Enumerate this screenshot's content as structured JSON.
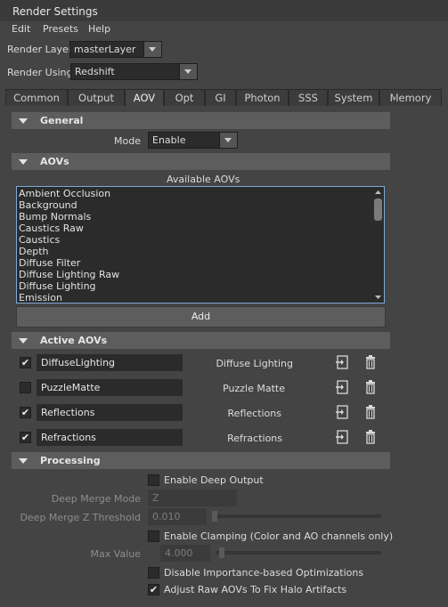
{
  "window": {
    "title": "Render Settings"
  },
  "menu": [
    "Edit",
    "Presets",
    "Help"
  ],
  "render_layer": {
    "label": "Render Layer",
    "value": "masterLayer"
  },
  "render_using": {
    "label": "Render Using",
    "value": "Redshift"
  },
  "tabs": [
    "Common",
    "Output",
    "AOV",
    "Opt",
    "GI",
    "Photon",
    "SSS",
    "System",
    "Memory"
  ],
  "active_tab": "AOV",
  "general": {
    "title": "General",
    "mode_label": "Mode",
    "mode_value": "Enable"
  },
  "aovs": {
    "title": "AOVs",
    "available_label": "Available AOVs",
    "items": [
      "Ambient Occlusion",
      "Background",
      "Bump Normals",
      "Caustics Raw",
      "Caustics",
      "Depth",
      "Diffuse Filter",
      "Diffuse Lighting Raw",
      "Diffuse Lighting",
      "Emission"
    ],
    "add_label": "Add"
  },
  "active_aovs": {
    "title": "Active AOVs",
    "rows": [
      {
        "checked": true,
        "name": "DiffuseLighting",
        "type": "Diffuse Lighting"
      },
      {
        "checked": false,
        "name": "PuzzleMatte",
        "type": "Puzzle Matte"
      },
      {
        "checked": true,
        "name": "Reflections",
        "type": "Reflections"
      },
      {
        "checked": true,
        "name": "Refractions",
        "type": "Refractions"
      }
    ]
  },
  "processing": {
    "title": "Processing",
    "enable_deep_output": {
      "label": "Enable Deep Output",
      "checked": false
    },
    "deep_merge_mode": {
      "label": "Deep Merge Mode",
      "value": "Z"
    },
    "deep_merge_z_threshold": {
      "label": "Deep Merge Z Threshold",
      "value": "0.010"
    },
    "enable_clamping": {
      "label": "Enable Clamping (Color and AO channels only)",
      "checked": false
    },
    "max_value": {
      "label": "Max Value",
      "value": "4.000"
    },
    "disable_importance": {
      "label": "Disable Importance-based Optimizations",
      "checked": false
    },
    "adjust_raw_aovs": {
      "label": "Adjust Raw AOVs To Fix Halo Artifacts",
      "checked": true
    }
  },
  "icons": {
    "export": "export-icon",
    "delete": "trash-icon",
    "expand": "triangle-down-icon",
    "check": "checkmark-icon"
  }
}
